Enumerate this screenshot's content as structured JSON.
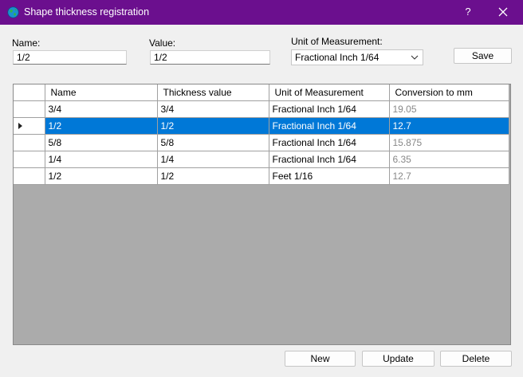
{
  "window": {
    "title": "Shape thickness registration",
    "help": "?",
    "colors": {
      "titlebar": "#6b0f8e",
      "selection": "#0078d7"
    },
    "icons": {
      "app": "globe-icon",
      "close": "close-icon"
    }
  },
  "form": {
    "name_label": "Name:",
    "name_value": "1/2",
    "value_label": "Value:",
    "value_value": "1/2",
    "unit_label": "Unit of Measurement:",
    "unit_selected": "Fractional Inch 1/64",
    "save_label": "Save"
  },
  "table": {
    "columns": [
      "Name",
      "Thickness value",
      "Unit of Measurement",
      "Conversion to mm"
    ],
    "rows": [
      {
        "name": "3/4",
        "value": "3/4",
        "unit": "Fractional Inch 1/64",
        "mm": "19.05"
      },
      {
        "name": "1/2",
        "value": "1/2",
        "unit": "Fractional Inch 1/64",
        "mm": "12.7"
      },
      {
        "name": "5/8",
        "value": "5/8",
        "unit": "Fractional Inch 1/64",
        "mm": "15.875"
      },
      {
        "name": "1/4",
        "value": "1/4",
        "unit": "Fractional Inch 1/64",
        "mm": "6.35"
      },
      {
        "name": "1/2",
        "value": "1/2",
        "unit": "Feet 1/16",
        "mm": "12.7"
      }
    ],
    "selected_index": 1
  },
  "actions": {
    "new_label": "New",
    "update_label": "Update",
    "delete_label": "Delete"
  }
}
